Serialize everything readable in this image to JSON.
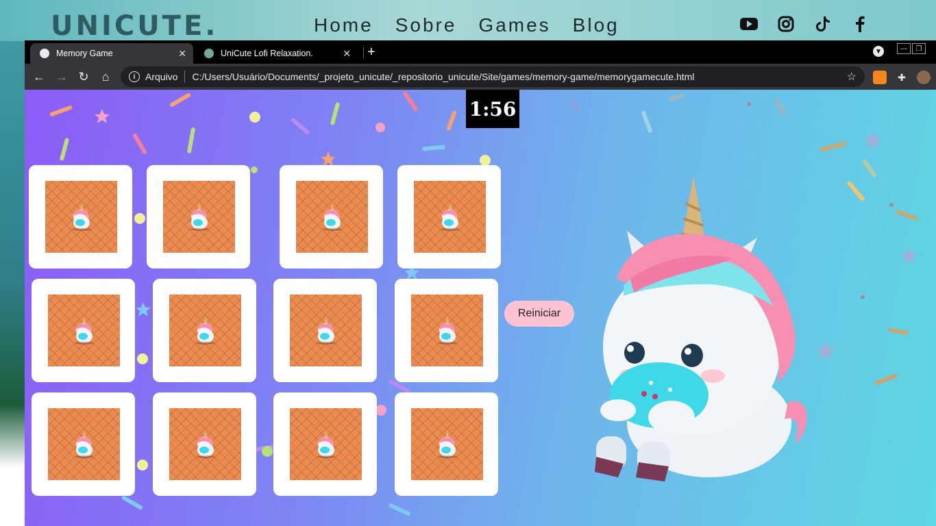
{
  "site": {
    "logo": "UNICUTE.",
    "nav": [
      "Home",
      "Sobre",
      "Games",
      "Blog"
    ],
    "social_icons": [
      "youtube-icon",
      "instagram-icon",
      "tiktok-icon",
      "facebook-icon"
    ]
  },
  "browser": {
    "tabs": [
      {
        "title": "Memory Game",
        "active": true,
        "favicon": "globe-icon"
      },
      {
        "title": "UniCute Lofi Relaxation.",
        "active": false,
        "favicon": "openai-icon"
      }
    ],
    "omnibox": {
      "site_label": "Arquivo",
      "url": "C:/Users/Usuário/Documents/_projeto_unicute/_repositorio_unicute/Site/games/memory-game/memorygamecute.html"
    },
    "extensions": [
      "metamask-fox-icon",
      "puzzle-icon",
      "profile-avatar"
    ]
  },
  "game": {
    "timer": "1:56",
    "restart_label": "Reiniciar",
    "card_count": 12,
    "card_state": "face-down"
  },
  "colors": {
    "page_gradient_start": "#8c5cf7",
    "page_gradient_end": "#5ed8e2",
    "card_back": "#f08a4b",
    "restart_button": "#fdc3d3",
    "timer_bg": "#000000"
  }
}
